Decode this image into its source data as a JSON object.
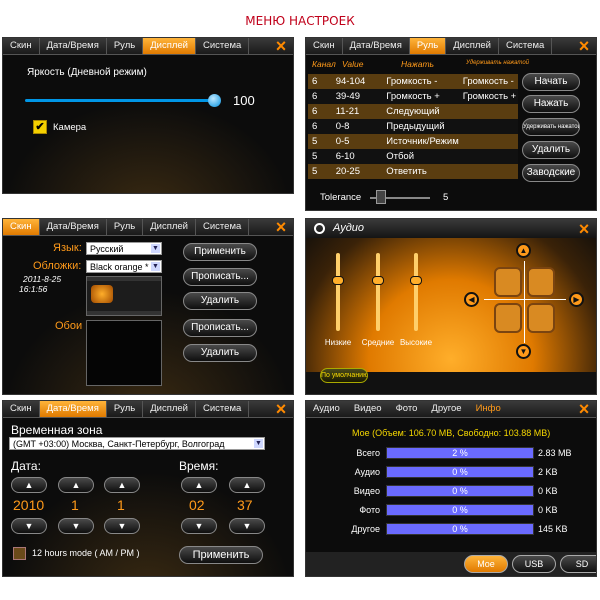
{
  "page_title": "МЕНЮ НАСТРОЕК",
  "tabs": [
    "Скин",
    "Дата/Время",
    "Руль",
    "Дисплей",
    "Система"
  ],
  "close_icon": "×",
  "display": {
    "brightness_label": "Яркость (Дневной режим)",
    "brightness_value": "100",
    "brightness_level": 1.0,
    "camera_label": "Камера",
    "camera_checked": true
  },
  "wheel": {
    "headers": [
      "Канал",
      "Value",
      "Нажать",
      "Удерживать нажатой"
    ],
    "rows": [
      [
        "6",
        "94-104",
        "Громкость -",
        "Громкость -"
      ],
      [
        "6",
        "39-49",
        "Громкость +",
        "Громкость +"
      ],
      [
        "6",
        "11-21",
        "Следующий",
        ""
      ],
      [
        "6",
        "0-8",
        "Предыдущий",
        ""
      ],
      [
        "5",
        "0-5",
        "Источник/Режим",
        ""
      ],
      [
        "5",
        "6-10",
        "Отбой",
        ""
      ],
      [
        "5",
        "20-25",
        "Ответить",
        ""
      ]
    ],
    "buttons": [
      "Начать",
      "Нажать",
      "Удерживать нажатой",
      "Удалить",
      "Заводские"
    ],
    "tolerance_label": "Tolerance",
    "tolerance_value": "5"
  },
  "skin": {
    "language_label": "Язык:",
    "language_value": "Русский",
    "skin_label": "Обложки:",
    "skin_value": "Black orange *",
    "date": "2011-8-25",
    "time": "16:1:56",
    "wallpaper_label": "Обои",
    "buttons": [
      "Применить",
      "Прописать...",
      "Удалить",
      "Прописать...",
      "Удалить"
    ]
  },
  "audio": {
    "title": "Аудио",
    "sliders": [
      {
        "label": "Низкие",
        "level": 0.65
      },
      {
        "label": "Средние",
        "level": 0.65
      },
      {
        "label": "Высокие",
        "level": 0.65
      }
    ],
    "default_button": "По умолчанию"
  },
  "datetime": {
    "timezone_label": "Временная зона",
    "timezone_value": "(GMT +03:00) Москва, Санкт-Петербург, Волгоград",
    "date_label": "Дата:",
    "time_label": "Время:",
    "year": "2010",
    "month": "1",
    "day": "1",
    "hour": "02",
    "minute": "37",
    "twelve_hours_label": "12 hours mode ( AM / PM )",
    "apply_button": "Применить"
  },
  "info": {
    "tabs": [
      "Аудио",
      "Видео",
      "Фото",
      "Другое",
      "Инфо"
    ],
    "summary": "Мое (Объем: 106.70 MB, Свободно: 103.88 MB)",
    "rows": [
      {
        "label": "Всего",
        "percent": "2 %",
        "size": "2.83 MB"
      },
      {
        "label": "Аудио",
        "percent": "0 %",
        "size": "2 KB"
      },
      {
        "label": "Видео",
        "percent": "0 %",
        "size": "0 KB"
      },
      {
        "label": "Фото",
        "percent": "0 %",
        "size": "0 KB"
      },
      {
        "label": "Другое",
        "percent": "0 %",
        "size": "145 KB"
      }
    ],
    "storage_tabs": [
      "Мое",
      "USB",
      "SD"
    ]
  }
}
